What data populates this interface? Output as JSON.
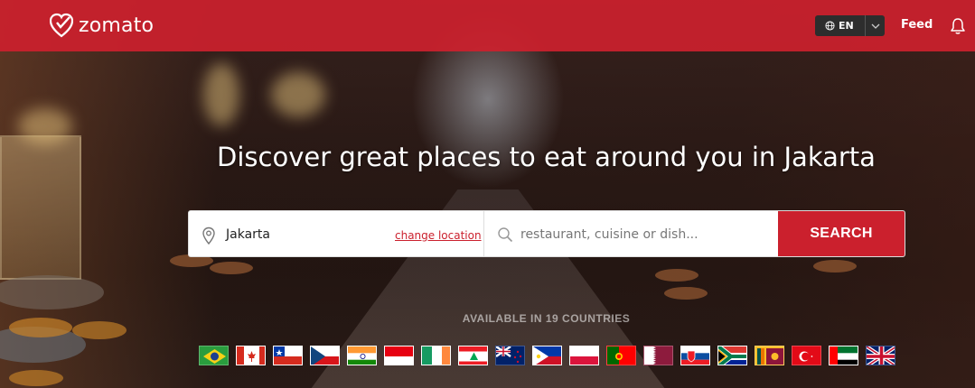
{
  "header": {
    "brand": "zomato",
    "language": "EN",
    "feed_label": "Feed"
  },
  "hero": {
    "headline": "Discover great places to eat around you in Jakarta"
  },
  "search": {
    "location_value": "Jakarta",
    "change_location_label": "change location",
    "query_placeholder": "restaurant, cuisine or dish...",
    "button_label": "SEARCH"
  },
  "countries": {
    "label": "AVAILABLE IN 19 COUNTRIES",
    "flags": [
      "Brazil",
      "Canada",
      "Chile",
      "Czech Republic",
      "India",
      "Indonesia",
      "Ireland",
      "Lebanon",
      "New Zealand",
      "Philippines",
      "Poland",
      "Portugal",
      "Qatar",
      "Slovakia",
      "South Africa",
      "Sri Lanka",
      "Turkey",
      "UAE",
      "United Kingdom"
    ]
  },
  "colors": {
    "brand_red": "#cb202d"
  }
}
